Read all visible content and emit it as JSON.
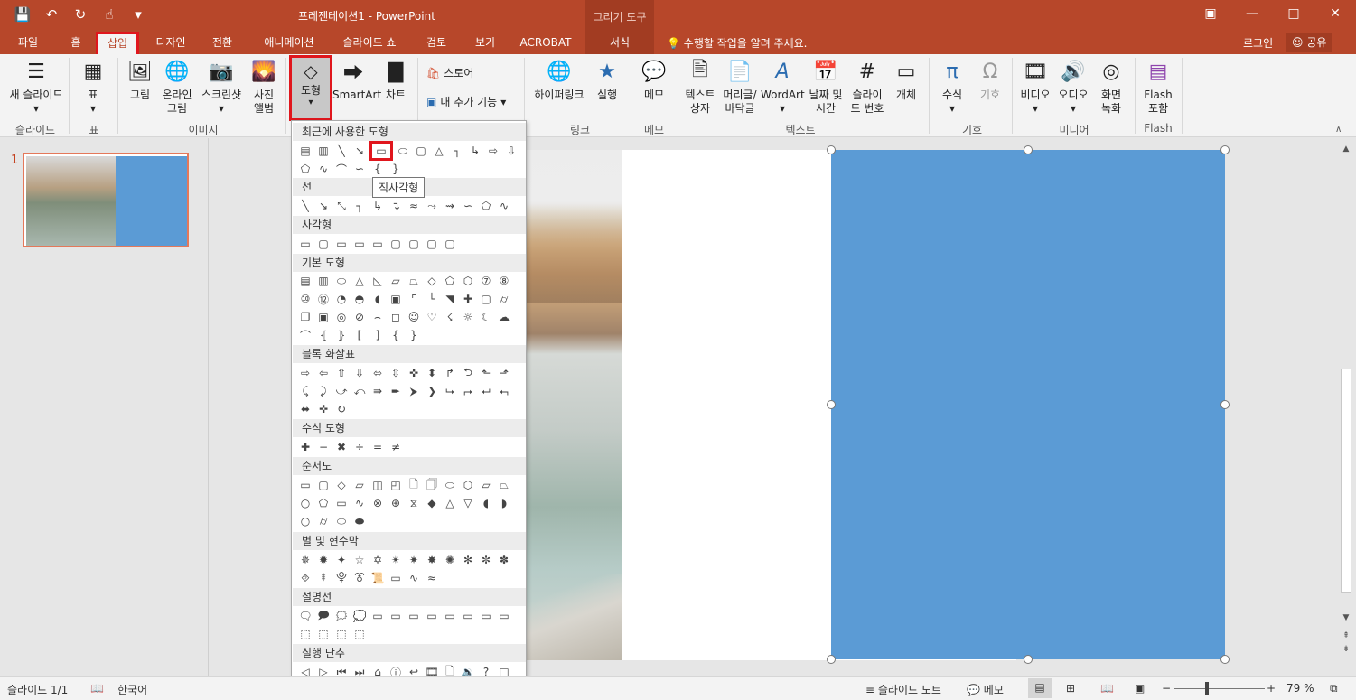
{
  "window": {
    "title": "프레젠테이션1 - PowerPoint",
    "context_tab_header": "그리기 도구"
  },
  "tabs": [
    "파일",
    "홈",
    "삽입",
    "디자인",
    "전환",
    "애니메이션",
    "슬라이드 쇼",
    "검토",
    "보기",
    "ACROBAT",
    "서식"
  ],
  "active_tab": "삽입",
  "tell_me": "수행할 작업을 알려 주세요.",
  "login": "로그인",
  "share": "공유",
  "ribbon": {
    "new_slide": "새 슬라이드",
    "table": "표",
    "picture": "그림",
    "online_picture": "온라인 그림",
    "screenshot": "스크린샷",
    "photo_album": "사진 앨범",
    "shapes": "도형",
    "smartart": "SmartArt",
    "chart": "차트",
    "store": "스토어",
    "my_addins": "내 추가 기능",
    "hyperlink": "하이퍼링크",
    "action": "실행",
    "comment": "메모",
    "textbox": "텍스트 상자",
    "header_footer": "머리글/ 바닥글",
    "wordart": "WordArt",
    "datetime": "날짜 및 시간",
    "slide_number": "슬라이 드 번호",
    "object": "개체",
    "equation": "수식",
    "symbol": "기호",
    "video": "비디오",
    "audio": "오디오",
    "screen_recording": "화면 녹화",
    "flash": "Flash 포함",
    "groups": {
      "slides": "슬라이드",
      "table": "표",
      "images": "이미지",
      "links": "링크",
      "comments": "메모",
      "text": "텍스트",
      "symbols": "기호",
      "media": "미디어",
      "flash": "Flash"
    }
  },
  "shapes_menu": {
    "sections": [
      "최근에 사용한 도형",
      "선",
      "사각형",
      "기본 도형",
      "블록 화살표",
      "수식 도형",
      "순서도",
      "별 및 현수막",
      "설명선",
      "실행 단추"
    ],
    "tooltip": "직사각형"
  },
  "slide_panel": {
    "slide_number": "1"
  },
  "status": {
    "slide_info": "슬라이드 1/1",
    "language": "한국어",
    "notes": "슬라이드 노트",
    "comments": "메모",
    "zoom": "79 %"
  },
  "colors": {
    "accent": "#b7472a",
    "shape_fill": "#5b9bd5",
    "highlight": "#e0161d"
  }
}
